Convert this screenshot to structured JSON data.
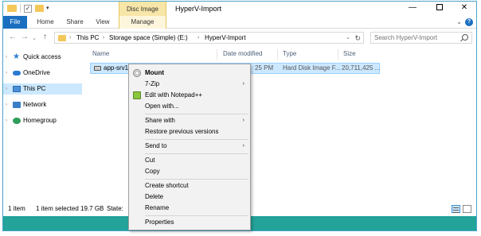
{
  "window": {
    "title": "HyperV-Import",
    "contextual_tab_group": "Disc Image Tools",
    "minimize": "—",
    "close": "✕"
  },
  "ribbon": {
    "tabs": [
      "File",
      "Home",
      "Share",
      "View",
      "Manage"
    ]
  },
  "address": {
    "crumbs": [
      "This PC",
      "Storage space (Simple) (E:)",
      "HyperV-Import"
    ],
    "search_placeholder": "Search HyperV-Import"
  },
  "nav_pane": {
    "items": [
      {
        "label": "Quick access",
        "icon": "star-icon"
      },
      {
        "label": "OneDrive",
        "icon": "cloud-icon"
      },
      {
        "label": "This PC",
        "icon": "computer-icon",
        "selected": true
      },
      {
        "label": "Network",
        "icon": "network-icon"
      },
      {
        "label": "Homegroup",
        "icon": "homegroup-icon"
      }
    ]
  },
  "file_list": {
    "columns": [
      "Name",
      "Date modified",
      "Type",
      "Size"
    ],
    "rows": [
      {
        "name": "app-srv1.V",
        "date": "25 PM",
        "type": "Hard Disk Image F...",
        "size": "20,711,425 ..."
      }
    ]
  },
  "status": {
    "item_count": "1 item",
    "selection": "1 item selected  19.7 GB",
    "state_label": "State:"
  },
  "context_menu": {
    "items": [
      {
        "label": "Mount",
        "bold": true,
        "icon": "disc-icon"
      },
      {
        "label": "7-Zip",
        "submenu": true
      },
      {
        "label": "Edit with Notepad++",
        "icon": "notepad-plus-plus-icon"
      },
      {
        "label": "Open with..."
      },
      {
        "label": "Share with",
        "submenu": true
      },
      {
        "label": "Restore previous versions"
      },
      {
        "label": "Send to",
        "submenu": true
      },
      {
        "label": "Cut"
      },
      {
        "label": "Copy"
      },
      {
        "label": "Create shortcut"
      },
      {
        "label": "Delete"
      },
      {
        "label": "Rename"
      },
      {
        "label": "Properties"
      }
    ]
  },
  "colors": {
    "accent": "#1a6fc1",
    "selection": "#cce8ff",
    "contextual_tab": "#f7e6a8",
    "taskbar_teal": "#23a39a"
  }
}
